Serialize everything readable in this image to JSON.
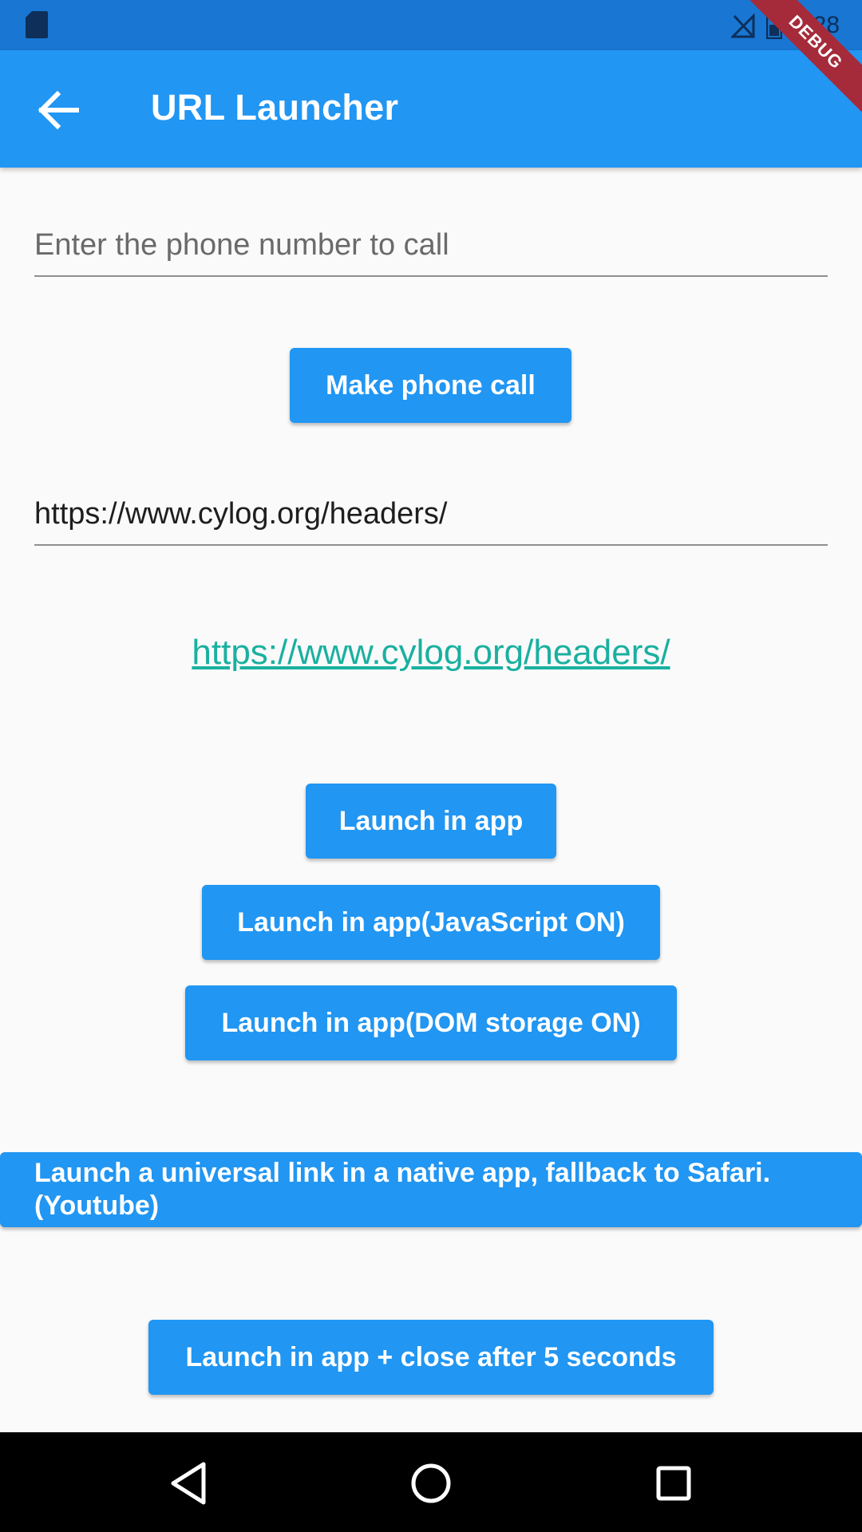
{
  "status_bar": {
    "time": "1:28",
    "icons": [
      "sd-card-icon",
      "no-signal-icon",
      "battery-icon"
    ]
  },
  "app_bar": {
    "title": "URL Launcher",
    "back_icon": "arrow-left-icon",
    "debug_banner": "DEBUG",
    "color": "#2196f3"
  },
  "phone_section": {
    "placeholder": "Enter the phone number to call",
    "value": "",
    "call_button": "Make phone call"
  },
  "url_section": {
    "url_value": "https://www.cylog.org/headers/",
    "link_text": "https://www.cylog.org/headers/",
    "link_color": "#1ab0a0"
  },
  "buttons": {
    "launch_in_app": "Launch in app",
    "launch_js": "Launch in app(JavaScript ON)",
    "launch_dom": "Launch in app(DOM storage ON)",
    "universal_link": "Launch a universal link in a native app, fallback to Safari.(Youtube)",
    "universal_link_line1": "Launch a universal link in a native app, fallback to Safari.",
    "universal_link_line2": "(Youtube)",
    "launch_close": "Launch in app + close after 5 seconds"
  },
  "nav_bar": {
    "back": "triangle-back-icon",
    "home": "circle-home-icon",
    "recents": "square-recents-icon"
  }
}
